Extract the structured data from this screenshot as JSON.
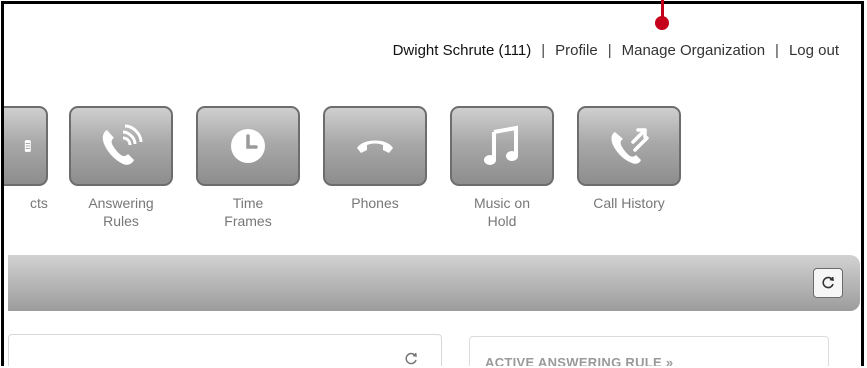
{
  "user_nav": {
    "user": "Dwight Schrute (111)",
    "sep": "|",
    "profile": "Profile",
    "manage_org": "Manage Organization",
    "logout": "Log out"
  },
  "nav_tiles": [
    {
      "label_line1": "cts",
      "label_line2": "",
      "icon": "contacts-icon"
    },
    {
      "label_line1": "Answering",
      "label_line2": "Rules",
      "icon": "answering-rules-icon"
    },
    {
      "label_line1": "Time",
      "label_line2": "Frames",
      "icon": "clock-icon"
    },
    {
      "label_line1": "Phones",
      "label_line2": "",
      "icon": "phone-handset-icon"
    },
    {
      "label_line1": "Music on",
      "label_line2": "Hold",
      "icon": "music-note-icon"
    },
    {
      "label_line1": "Call History",
      "label_line2": "",
      "icon": "call-history-icon"
    }
  ],
  "panels": {
    "active_rule_title": "ACTIVE ANSWERING RULE »"
  },
  "colors": {
    "marker": "#c4001a",
    "tile_top": "#cfcfcf",
    "tile_bottom": "#8d8d8d"
  }
}
